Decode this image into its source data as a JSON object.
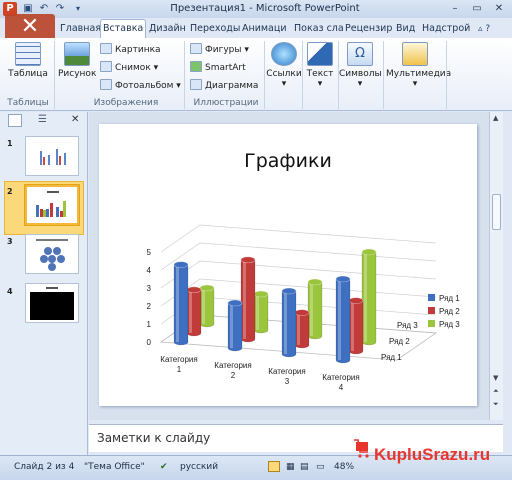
{
  "titlebar": {
    "title": "Презентация1  -  Microsoft PowerPoint",
    "app_icon": "P",
    "quick_access": [
      "save-icon",
      "undo-icon",
      "redo-icon",
      "customize-icon"
    ],
    "window_buttons": [
      "–",
      "▭",
      "✕"
    ]
  },
  "file_tab": {
    "label": "✕"
  },
  "tabs": [
    "Главная",
    "Вставка",
    "Дизайн",
    "Переходы",
    "Анимаци",
    "Показ сла",
    "Рецензир",
    "Вид",
    "Надстрой"
  ],
  "active_tab": "Вставка",
  "ribbon": {
    "table_group": {
      "button": "Таблица",
      "label": "Таблицы"
    },
    "images_group": {
      "big_button": "Рисунок",
      "items": [
        "Картинка",
        "Снимок",
        "Фотоальбом"
      ],
      "label": "Изображения"
    },
    "illustrations_group": {
      "items": [
        "Фигуры",
        "SmartArt",
        "Диаграмма"
      ],
      "label": "Иллюстрации"
    },
    "links": "Ссылки",
    "text": "Текст",
    "symbols": "Символы",
    "media": "Мультимедиа"
  },
  "slides_panel": {
    "numbers": [
      "1",
      "2",
      "3",
      "4"
    ],
    "selected": 2
  },
  "slide": {
    "title": "Графики"
  },
  "chart_data": {
    "type": "bar",
    "variant": "3d-cylinder",
    "categories": [
      "Категория 1",
      "Категория 2",
      "Категория 3",
      "Категория 4"
    ],
    "category_lines": [
      [
        "Категория",
        "1"
      ],
      [
        "Категория",
        "2"
      ],
      [
        "Категория",
        "3"
      ],
      [
        "Категория",
        "4"
      ]
    ],
    "series": [
      {
        "name": "Ряд 1",
        "color": "#3f6fc0",
        "values": [
          4.3,
          2.5,
          3.5,
          4.5
        ]
      },
      {
        "name": "Ряд 2",
        "color": "#c23b3b",
        "values": [
          2.4,
          4.4,
          1.8,
          2.8
        ]
      },
      {
        "name": "Ряд 3",
        "color": "#9bc53d",
        "values": [
          2.0,
          2.0,
          3.0,
          5.0
        ]
      }
    ],
    "depth_labels": [
      "Ряд 1",
      "Ряд 2",
      "Ряд 3"
    ],
    "y_ticks": [
      "0",
      "1",
      "2",
      "3",
      "4",
      "5"
    ],
    "ylim": [
      0,
      5
    ],
    "legend": "right"
  },
  "notes": {
    "placeholder": "Заметки к слайду"
  },
  "status": {
    "slide": "Слайд 2 из 4",
    "theme": "\"Тема Office\"",
    "language": "русский",
    "zoom": "48%"
  },
  "watermark": {
    "text": "KupluSrazu.ru"
  }
}
